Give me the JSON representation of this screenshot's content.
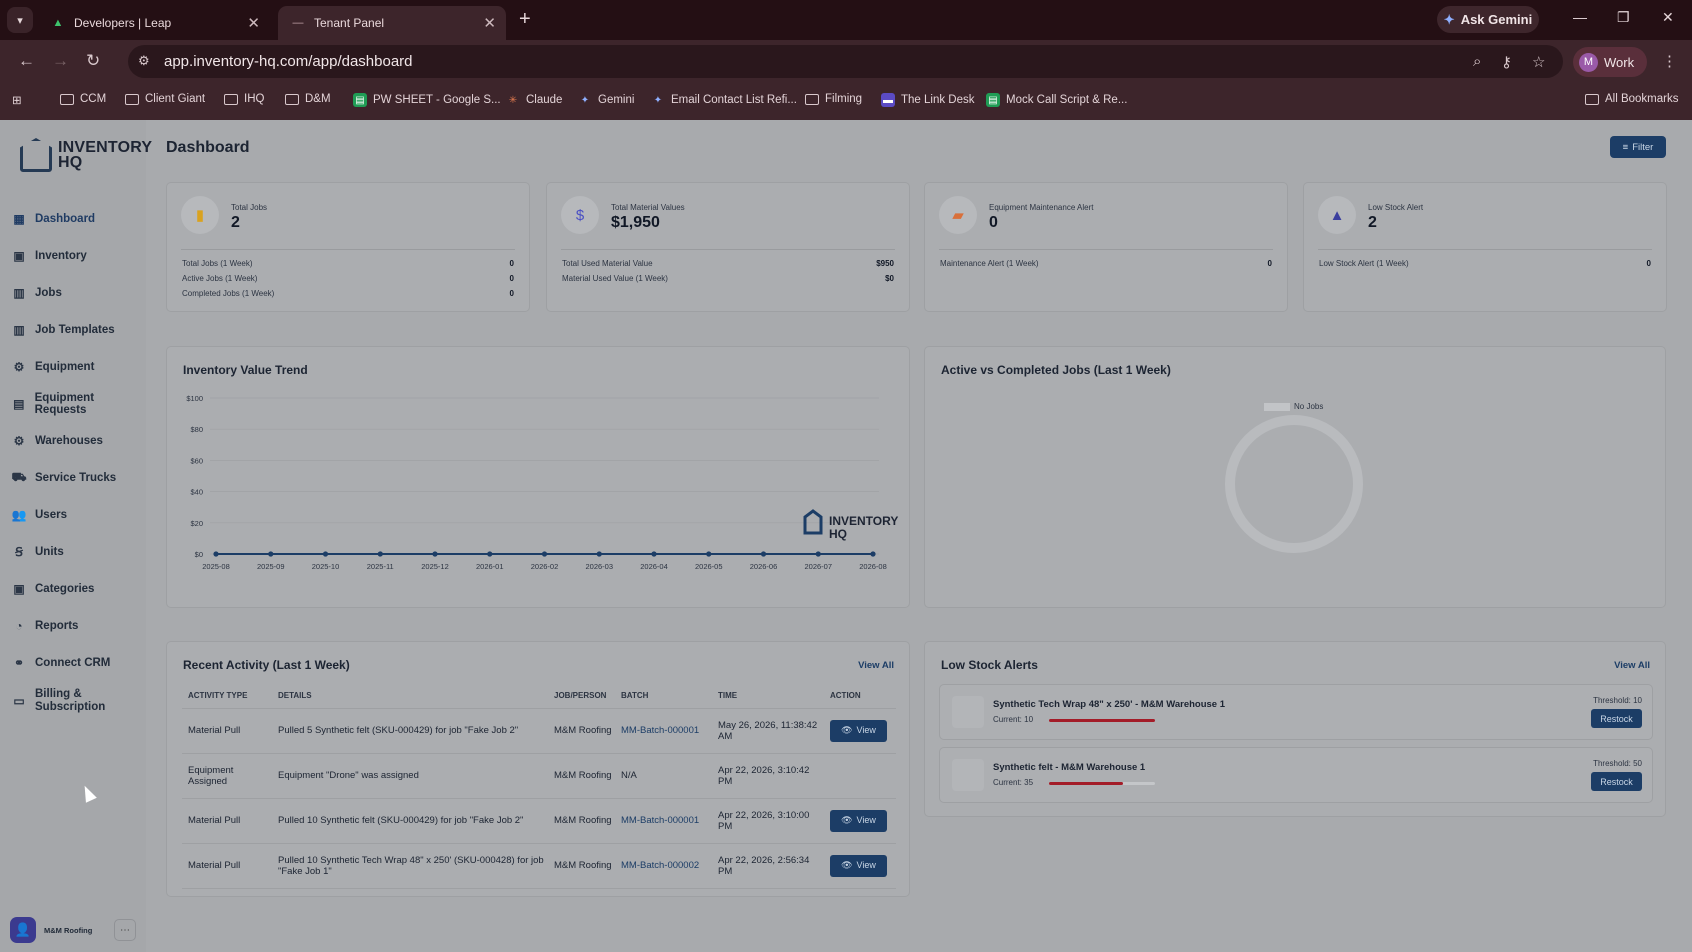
{
  "browser": {
    "tabs": [
      {
        "title": "Developers | Leap",
        "icon": "leap-logo-icon"
      },
      {
        "title": "Tenant Panel",
        "icon": "tenant-panel-icon"
      }
    ],
    "ask_gemini": "Ask Gemini",
    "url": "app.inventory-hq.com/app/dashboard",
    "profile_initial": "M",
    "profile_name": "Work",
    "bookmarks": [
      {
        "label": "CCM",
        "type": "folder"
      },
      {
        "label": "Client Giant",
        "type": "folder"
      },
      {
        "label": "IHQ",
        "type": "folder"
      },
      {
        "label": "D&M",
        "type": "folder"
      },
      {
        "label": "PW SHEET - Google S...",
        "type": "sheets"
      },
      {
        "label": "Claude",
        "type": "claude"
      },
      {
        "label": "Gemini",
        "type": "gemini"
      },
      {
        "label": "Email Contact List Refi...",
        "type": "gemini"
      },
      {
        "label": "Filming",
        "type": "folder"
      },
      {
        "label": "The Link Desk",
        "type": "linkdesk"
      },
      {
        "label": "Mock Call Script & Re...",
        "type": "sheets"
      }
    ],
    "all_bookmarks": "All Bookmarks"
  },
  "logo": {
    "line1": "INVENTORY",
    "line2": "HQ"
  },
  "sidebar": {
    "items": [
      {
        "label": "Dashboard",
        "icon": "dashboard-icon",
        "active": true
      },
      {
        "label": "Inventory",
        "icon": "inventory-icon"
      },
      {
        "label": "Jobs",
        "icon": "jobs-icon"
      },
      {
        "label": "Job Templates",
        "icon": "job-templates-icon"
      },
      {
        "label": "Equipment",
        "icon": "equipment-icon"
      },
      {
        "label": "Equipment Requests",
        "icon": "equipment-requests-icon"
      },
      {
        "label": "Warehouses",
        "icon": "warehouses-icon"
      },
      {
        "label": "Service Trucks",
        "icon": "truck-icon"
      },
      {
        "label": "Users",
        "icon": "users-icon"
      },
      {
        "label": "Units",
        "icon": "units-icon"
      },
      {
        "label": "Categories",
        "icon": "categories-icon"
      },
      {
        "label": "Reports",
        "icon": "reports-icon"
      },
      {
        "label": "Connect CRM",
        "icon": "crm-icon"
      },
      {
        "label": "Billing & Subscription",
        "icon": "billing-icon"
      }
    ],
    "user": "M&M Roofing"
  },
  "header": {
    "title": "Dashboard",
    "filter": "Filter"
  },
  "stats": [
    {
      "label": "Total Jobs",
      "value": "2",
      "icon": "briefcase-icon",
      "color": "#d9a21f",
      "rows": [
        {
          "k": "Total Jobs (1 Week)",
          "v": "0"
        },
        {
          "k": "Active Jobs (1 Week)",
          "v": "0"
        },
        {
          "k": "Completed Jobs (1 Week)",
          "v": "0"
        }
      ]
    },
    {
      "label": "Total Material Values",
      "value": "$1,950",
      "icon": "dollar-icon",
      "color": "#4a4fc4",
      "rows": [
        {
          "k": "Total Used Material Value",
          "v": "$950"
        },
        {
          "k": "Material Used Value (1 Week)",
          "v": "$0"
        }
      ]
    },
    {
      "label": "Equipment Maintenance Alert",
      "value": "0",
      "icon": "toolbox-icon",
      "color": "#d9703a",
      "rows": [
        {
          "k": "Maintenance Alert (1 Week)",
          "v": "0"
        }
      ]
    },
    {
      "label": "Low Stock Alert",
      "value": "2",
      "icon": "warning-icon",
      "color": "#3b3f9e",
      "rows": [
        {
          "k": "Low Stock Alert (1 Week)",
          "v": "0"
        }
      ]
    }
  ],
  "chart_data": {
    "type": "line",
    "title": "Inventory Value Trend",
    "x": [
      "2025-08",
      "2025-09",
      "2025-10",
      "2025-11",
      "2025-12",
      "2026-01",
      "2026-02",
      "2026-03",
      "2026-04",
      "2026-05",
      "2026-06",
      "2026-07",
      "2026-08"
    ],
    "series": [
      {
        "values": [
          0,
          0,
          0,
          0,
          0,
          0,
          0,
          0,
          0,
          0,
          0,
          0,
          0
        ]
      }
    ],
    "yticks": [
      "$0",
      "$20",
      "$40",
      "$60",
      "$80",
      "$100"
    ],
    "ylim": [
      0,
      100
    ],
    "grid": true,
    "color": "#1c3d66",
    "watermark": {
      "line1": "INVENTORY",
      "line2": "HQ"
    }
  },
  "donut": {
    "title": "Active vs Completed Jobs (Last 1 Week)",
    "legend": "No Jobs"
  },
  "activity": {
    "title": "Recent Activity (Last 1 Week)",
    "view_all": "View All",
    "columns": [
      "ACTIVITY TYPE",
      "DETAILS",
      "JOB/PERSON",
      "BATCH",
      "TIME",
      "ACTION"
    ],
    "rows": [
      {
        "type": "Material Pull",
        "details": "Pulled 5 Synthetic felt (SKU-000429) for job \"Fake Job 2\"",
        "person": "M&M Roofing",
        "batch": "MM-Batch-000001",
        "time": "May 26, 2026, 11:38:42 AM",
        "action": "View"
      },
      {
        "type": "Equipment Assigned",
        "details": "Equipment \"Drone\" was assigned",
        "person": "M&M Roofing",
        "batch": "N/A",
        "time": "Apr 22, 2026, 3:10:42 PM",
        "action": ""
      },
      {
        "type": "Material Pull",
        "details": "Pulled 10 Synthetic felt (SKU-000429) for job \"Fake Job 2\"",
        "person": "M&M Roofing",
        "batch": "MM-Batch-000001",
        "time": "Apr 22, 2026, 3:10:00 PM",
        "action": "View"
      },
      {
        "type": "Material Pull",
        "details": "Pulled 10 Synthetic Tech Wrap 48\" x 250' (SKU-000428) for job \"Fake Job 1\"",
        "person": "M&M Roofing",
        "batch": "MM-Batch-000002",
        "time": "Apr 22, 2026, 2:56:34 PM",
        "action": "View"
      }
    ]
  },
  "low_stock": {
    "title": "Low Stock Alerts",
    "view_all": "View All",
    "items": [
      {
        "name": "Synthetic Tech Wrap 48\" x 250' - M&M Warehouse 1",
        "current": "Current: 10",
        "threshold": "Threshold: 10",
        "level": 1.0,
        "action": "Restock"
      },
      {
        "name": "Synthetic felt - M&M Warehouse 1",
        "current": "Current: 35",
        "threshold": "Threshold: 50",
        "level": 0.7,
        "action": "Restock"
      }
    ]
  }
}
